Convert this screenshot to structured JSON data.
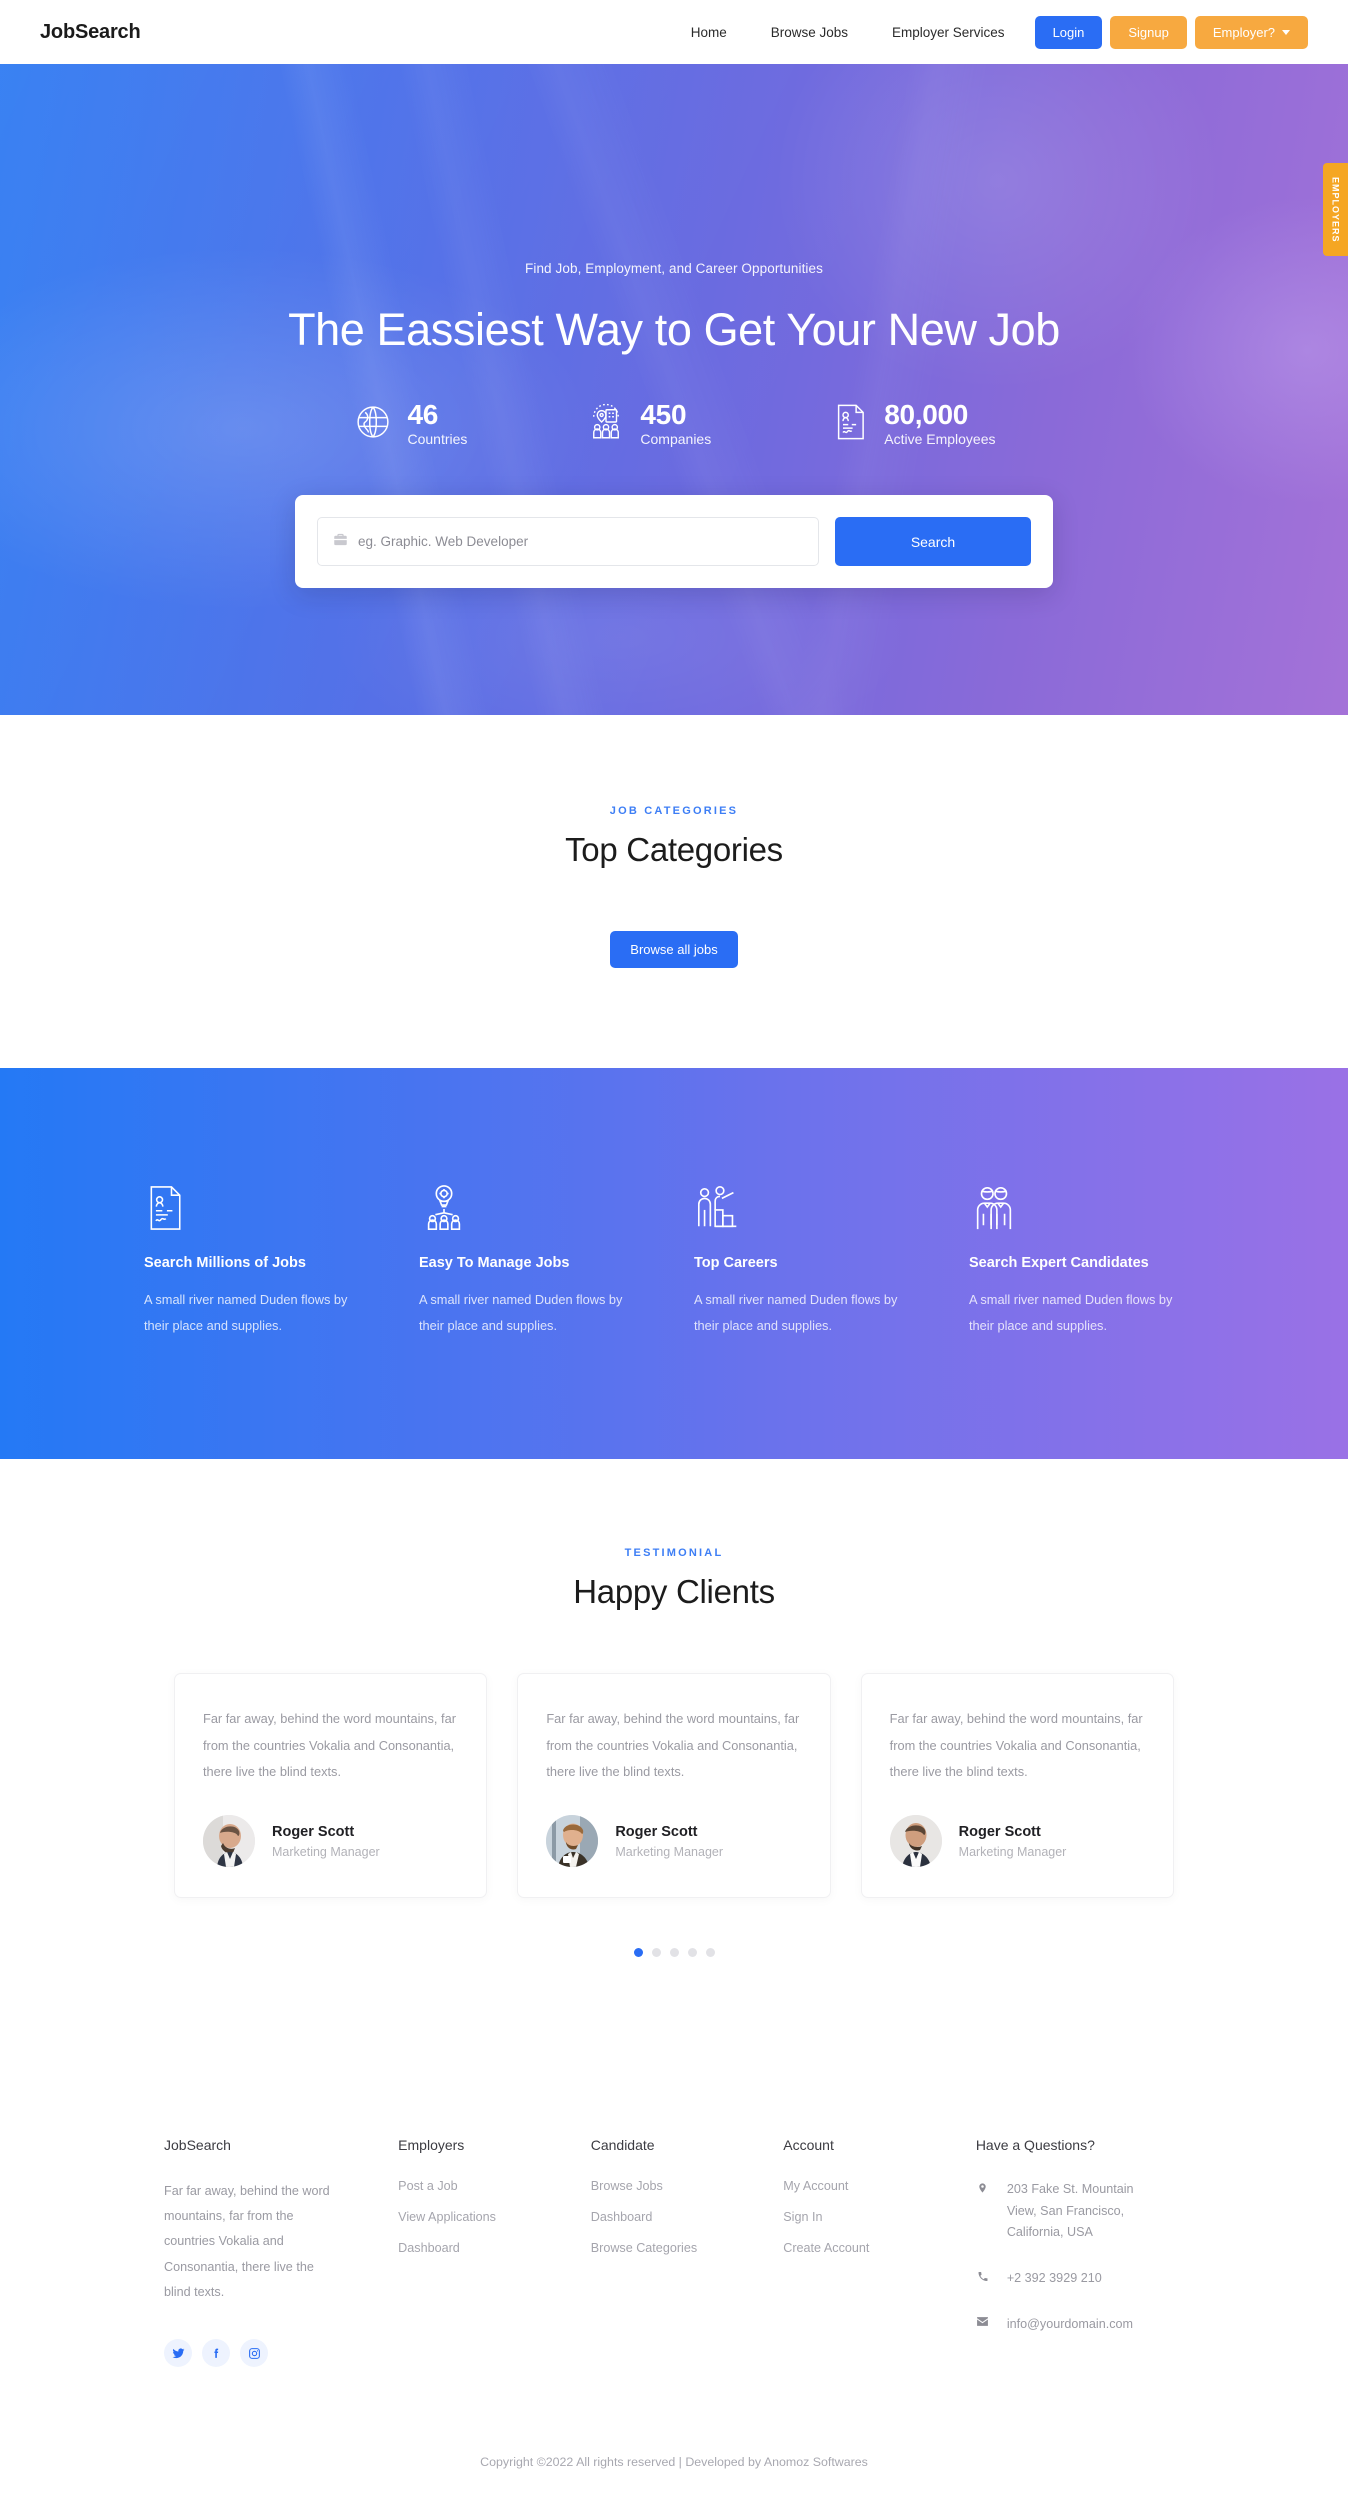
{
  "brand": "JobSearch",
  "nav": {
    "links": [
      {
        "label": "Home",
        "name": "nav-home"
      },
      {
        "label": "Browse Jobs",
        "name": "nav-browse-jobs"
      },
      {
        "label": "Employer Services",
        "name": "nav-employer-services"
      }
    ],
    "login_label": "Login",
    "signup_label": "Signup",
    "employer_label": "Employer?"
  },
  "side_tab": {
    "label": "EMPLOYERS"
  },
  "hero": {
    "eyebrow": "Find Job, Employment, and Career Opportunities",
    "title": "The Eassiest Way to Get Your New Job",
    "stats": [
      {
        "icon": "globe-icon",
        "value": "46",
        "label": "Countries"
      },
      {
        "icon": "companies-icon",
        "value": "450",
        "label": "Companies"
      },
      {
        "icon": "document-icon",
        "value": "80,000",
        "label": "Active Employees"
      }
    ],
    "search": {
      "icon": "briefcase-icon",
      "placeholder": "eg. Graphic. Web Developer",
      "value": "",
      "button_label": "Search"
    }
  },
  "categories": {
    "eyebrow": "JOB CATEGORIES",
    "title": "Top Categories",
    "button_label": "Browse all jobs"
  },
  "features": [
    {
      "icon": "resume-document-icon",
      "title": "Search Millions of Jobs",
      "desc": "A small river named Duden flows by their place and supplies."
    },
    {
      "icon": "idea-network-icon",
      "title": "Easy To Manage Jobs",
      "desc": "A small river named Duden flows by their place and supplies."
    },
    {
      "icon": "career-ladder-icon",
      "title": "Top Careers",
      "desc": "A small river named Duden flows by their place and supplies."
    },
    {
      "icon": "candidates-icon",
      "title": "Search Expert Candidates",
      "desc": "A small river named Duden flows by their place and supplies."
    }
  ],
  "testimonials": {
    "eyebrow": "TESTIMONIAL",
    "title": "Happy Clients",
    "cards": [
      {
        "quote": "Far far away, behind the word mountains, far from the countries Vokalia and Consonantia, there live the blind texts.",
        "name": "Roger Scott",
        "role": "Marketing Manager",
        "avatar": "avatar-bald-man"
      },
      {
        "quote": "Far far away, behind the word mountains, far from the countries Vokalia and Consonantia, there live the blind texts.",
        "name": "Roger Scott",
        "role": "Marketing Manager",
        "avatar": "avatar-man-with-cup"
      },
      {
        "quote": "Far far away, behind the word mountains, far from the countries Vokalia and Consonantia, there live the blind texts.",
        "name": "Roger Scott",
        "role": "Marketing Manager",
        "avatar": "avatar-smiling-man"
      }
    ],
    "dots_count": 5,
    "active_dot": 0
  },
  "footer": {
    "about": {
      "title": "JobSearch",
      "desc": "Far far away, behind the word mountains, far from the countries Vokalia and Consonantia, there live the blind texts.",
      "socials": [
        {
          "name": "twitter-icon"
        },
        {
          "name": "facebook-icon"
        },
        {
          "name": "instagram-icon"
        }
      ]
    },
    "employers": {
      "title": "Employers",
      "links": [
        "Post a Job",
        "View Applications",
        "Dashboard"
      ]
    },
    "candidate": {
      "title": "Candidate",
      "links": [
        "Browse Jobs",
        "Dashboard",
        "Browse Categories"
      ]
    },
    "account": {
      "title": "Account",
      "links": [
        "My Account",
        "Sign In",
        "Create Account"
      ]
    },
    "contact": {
      "title": "Have a Questions?",
      "address": "203 Fake St. Mountain View, San Francisco, California, USA",
      "phone": "+2 392 3929 210",
      "email": "info@yourdomain.com"
    },
    "copyright": "Copyright ©2022 All rights reserved | Developed by Anomoz Softwares"
  },
  "colors": {
    "primary_blue": "#2a6df4",
    "accent_orange": "#f7a940",
    "eyebrow_blue": "#3d7ef5",
    "hero_from": "#2f7bf2",
    "hero_to": "#a472d8"
  }
}
